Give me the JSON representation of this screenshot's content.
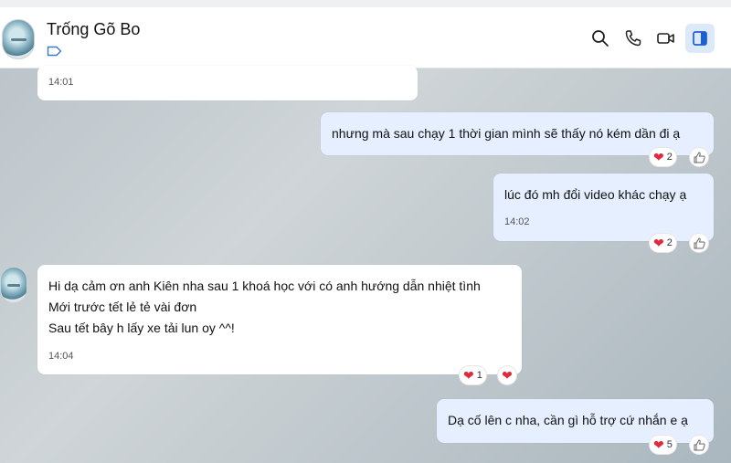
{
  "header": {
    "title": "Trống Gõ Bo"
  },
  "colors": {
    "heart": "#e0293d",
    "sent_bubble": "#e5efff",
    "accent": "#1d5fd1"
  },
  "messages": [
    {
      "id": "m0",
      "time": "14:01"
    },
    {
      "id": "m1",
      "text": "nhưng mà sau chạy 1 thời gian mình sẽ thấy nó kém dần đi ạ",
      "reaction_count": "2"
    },
    {
      "id": "m2",
      "text": "lúc đó mh đổi video khác chạy ạ",
      "time": "14:02",
      "reaction_count": "2"
    },
    {
      "id": "m3",
      "lines": [
        "Hi dạ cảm ơn anh Kiên nha sau 1 khoá học với có anh hướng dẫn nhiệt tình",
        "Mới trước tết lẻ tẻ vài đơn",
        "Sau tết bây h lấy xe tải lun oy ^^!"
      ],
      "time": "14:04",
      "reaction_count": "1"
    },
    {
      "id": "m4",
      "text": "Dạ cố lên c nha, cần gì hỗ trợ cứ nhắn e ạ",
      "reaction_count": "5"
    }
  ],
  "icons": [
    "search-icon",
    "phone-icon",
    "video-icon",
    "sidebar-toggle-icon",
    "tag-icon",
    "heart-icon",
    "thumbs-up-icon"
  ]
}
